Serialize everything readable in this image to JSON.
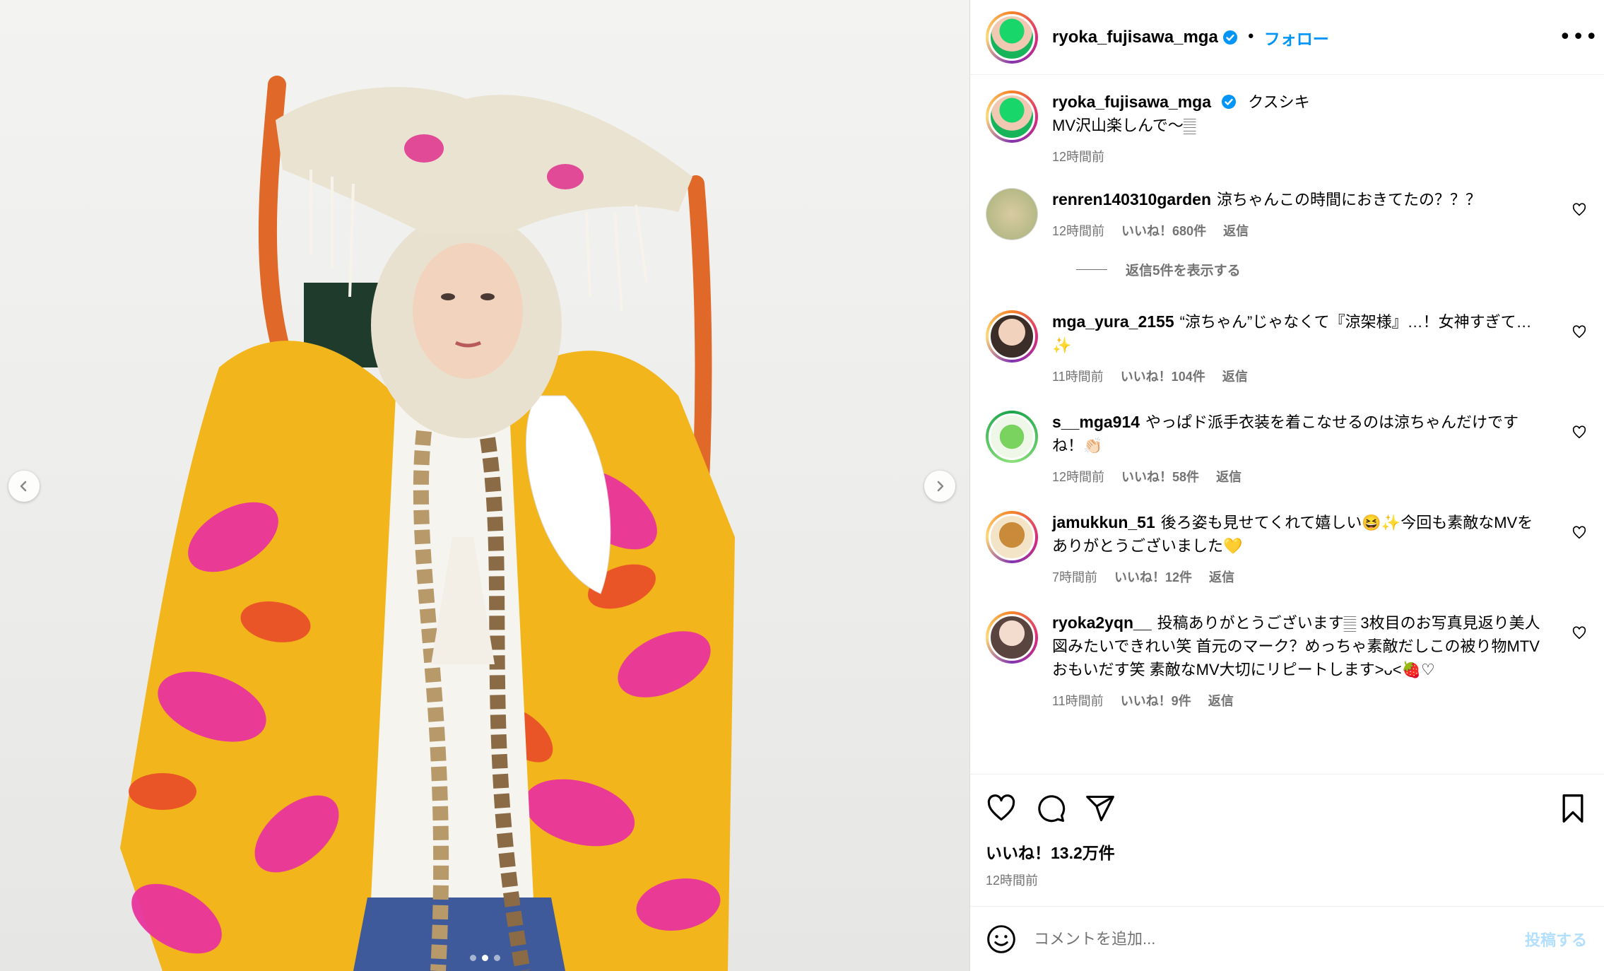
{
  "colors": {
    "accent": "#0095f6",
    "muted": "#737373",
    "divider": "#dbdbdb"
  },
  "media": {
    "prev_icon": "chevron-left-icon",
    "next_icon": "chevron-right-icon",
    "slide_count": 3,
    "active_slide": 1
  },
  "header": {
    "username": "ryoka_fujisawa_mga",
    "separator": "•",
    "follow_label": "フォロー",
    "more_icon": "ellipsis-icon"
  },
  "caption": {
    "username": "ryoka_fujisawa_mga",
    "text_line1": "クスシキ",
    "text_line2": "MV沢山楽しんで〜𝄛",
    "time": "12時間前"
  },
  "comments": [
    {
      "username": "renren140310garden",
      "text": "涼ちゃんこの時間におきてたの？？？",
      "time": "12時間前",
      "likes": "いいね！680件",
      "reply": "返信"
    },
    {
      "username": "mga_yura_2155",
      "text": "“涼ちゃん”じゃなくて『涼架様』…！女神すぎて…✨",
      "time": "11時間前",
      "likes": "いいね！104件",
      "reply": "返信"
    },
    {
      "username": "s__mga914",
      "text": "やっぱド派手衣装を着こなせるのは涼ちゃんだけですね！👏🏻",
      "time": "12時間前",
      "likes": "いいね！58件",
      "reply": "返信"
    },
    {
      "username": "jamukkun_51",
      "text": "後ろ姿も見せてくれて嬉しい😆✨今回も素敵なMVをありがとうございました💛",
      "time": "7時間前",
      "likes": "いいね！12件",
      "reply": "返信"
    },
    {
      "username": "ryoka2yqn__",
      "text": "投稿ありがとうございます𝄛 3枚目のお写真見返り美人図みたいできれい笑 首元のマーク？めっちゃ素敵だしこの被り物MTVおもいだす笑 素敵なMV大切にリピートします>ᴗ<🍓♡",
      "time": "11時間前",
      "likes": "いいね！9件",
      "reply": "返信"
    }
  ],
  "view_replies": "返信5件を表示する",
  "actions": {
    "like_icon": "heart-icon",
    "comment_icon": "comment-icon",
    "share_icon": "share-icon",
    "save_icon": "bookmark-icon",
    "likes_count": "いいね！13.2万件",
    "posted_time": "12時間前"
  },
  "add_comment": {
    "placeholder": "コメントを追加...",
    "post_label": "投稿する",
    "emoji_icon": "emoji-icon"
  }
}
